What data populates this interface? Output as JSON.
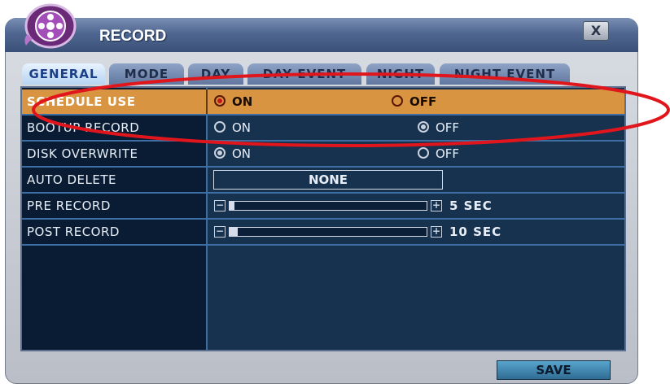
{
  "window": {
    "title": "RECORD",
    "close_label": "X"
  },
  "tabs": [
    {
      "label": "GENERAL",
      "active": true
    },
    {
      "label": "MODE",
      "active": false
    },
    {
      "label": "DAY",
      "active": false
    },
    {
      "label": "DAY EVENT",
      "active": false
    },
    {
      "label": "NIGHT",
      "active": false
    },
    {
      "label": "NIGHT EVENT",
      "active": false
    }
  ],
  "settings": {
    "schedule_use": {
      "label": "SCHEDULE USE",
      "on_label": "ON",
      "off_label": "OFF",
      "value": "ON"
    },
    "bootup_record": {
      "label": "BOOTUP RECORD",
      "on_label": "ON",
      "off_label": "OFF",
      "value": "OFF"
    },
    "disk_overwrite": {
      "label": "DISK OVERWRITE",
      "on_label": "ON",
      "off_label": "OFF",
      "value": "ON"
    },
    "auto_delete": {
      "label": "AUTO DELETE",
      "value": "NONE"
    },
    "pre_record": {
      "label": "PRE RECORD",
      "value": "5 SEC",
      "level": 0.02
    },
    "post_record": {
      "label": "POST RECORD",
      "value": "10 SEC",
      "level": 0.04
    }
  },
  "buttons": {
    "save": "SAVE"
  },
  "colors": {
    "selected_row": "#d89440",
    "panel_bg": "#0f2742",
    "annotation": "#e0161c"
  },
  "icons": {
    "logo": "film-reel-icon",
    "close": "close-icon"
  }
}
